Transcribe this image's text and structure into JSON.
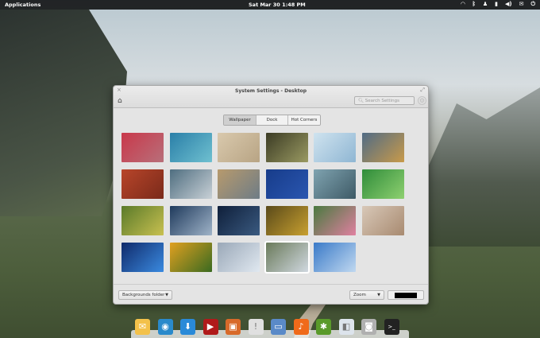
{
  "panel": {
    "apps": "Applications",
    "clock": "Sat Mar 30  1:48 PM",
    "indicators": [
      "wifi-icon",
      "bluetooth-icon",
      "user-icon",
      "battery-icon",
      "volume-icon",
      "mail-icon",
      "power-icon"
    ]
  },
  "window": {
    "title": "System Settings - Desktop",
    "search_placeholder": "Search Settings",
    "tabs": [
      {
        "label": "Wallpaper",
        "active": true
      },
      {
        "label": "Dock"
      },
      {
        "label": "Hot Corners"
      }
    ],
    "wallpapers": [
      [
        "#c9384a",
        "#b86f7a"
      ],
      [
        "#2a7fa8",
        "#6fc0d0"
      ],
      [
        "#d9c9ad",
        "#b8a484"
      ],
      [
        "#3b3b24",
        "#9a9a62"
      ],
      [
        "#cfe3ef",
        "#8fb6d3"
      ],
      [
        "#506b85",
        "#c89a4a"
      ],
      [
        "#b8452a",
        "#7a2a1a"
      ],
      [
        "#4f6e80",
        "#c8d0d6"
      ],
      [
        "#b79a6d",
        "#6e7c86"
      ],
      [
        "#173c8a",
        "#2a56b0"
      ],
      [
        "#7fa3b0",
        "#3e5a66"
      ],
      [
        "#2f8c3a",
        "#8ed070"
      ],
      [
        "#5a7a2a",
        "#c8c050"
      ],
      [
        "#1f3a5c",
        "#9fb3c8"
      ],
      [
        "#0f1f3a",
        "#3a5a80"
      ],
      [
        "#5a4a1a",
        "#c8a030"
      ],
      [
        "#4a7a40",
        "#e080a0"
      ],
      [
        "#d8c8b8",
        "#a88a70"
      ],
      [
        "#102a6a",
        "#3a8ae0"
      ],
      [
        "#e0a020",
        "#3a6a20"
      ],
      [
        "#9aa8b8",
        "#e0e8f0"
      ],
      [
        "#6a7a5a",
        "#d0d8e0"
      ],
      [
        "#3a7ac8",
        "#c0d8f0"
      ]
    ],
    "selected_index": 21,
    "backgrounds_label": "Backgrounds folder",
    "mode_label": "Zoom",
    "color": "#000000"
  },
  "dock": [
    {
      "name": "mail",
      "color": "#f3c14a",
      "glyph": "✉"
    },
    {
      "name": "browser",
      "color": "#2a8acb",
      "glyph": "◉"
    },
    {
      "name": "downloads",
      "color": "#2a8ad8",
      "glyph": "⬇"
    },
    {
      "name": "video",
      "color": "#b01a1a",
      "glyph": "▶"
    },
    {
      "name": "photos",
      "color": "#d86a2a",
      "glyph": "▣"
    },
    {
      "name": "notes",
      "color": "#e0e0e0",
      "glyph": "!"
    },
    {
      "name": "files",
      "color": "#5a8ac8",
      "glyph": "▭"
    },
    {
      "name": "music",
      "color": "#f06a1a",
      "glyph": "♪"
    },
    {
      "name": "bug",
      "color": "#5a9a2a",
      "glyph": "✱"
    },
    {
      "name": "settings",
      "color": "#dde4ec",
      "glyph": "◧"
    },
    {
      "name": "camera",
      "color": "#b0b0b0",
      "glyph": "◙"
    },
    {
      "name": "terminal",
      "color": "#222",
      "glyph": ">_"
    }
  ]
}
